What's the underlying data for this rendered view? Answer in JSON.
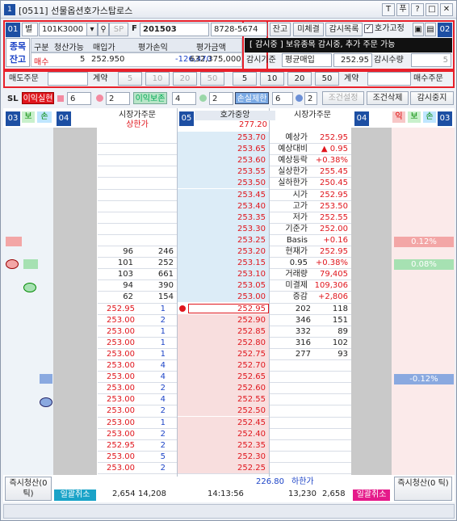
{
  "window": {
    "title": "[0511] 선물옵션호가스탑로스",
    "icon_num": "1",
    "tb_buttons": [
      "T",
      "푸",
      "?",
      "□",
      "✕"
    ]
  },
  "badges": [
    "01",
    "02",
    "03",
    "04",
    "05",
    "04",
    "03"
  ],
  "toolbar": {
    "dropdown1": "별",
    "code": "101K3000",
    "f_prefix": "F",
    "f_code": "201503",
    "account": "8728-5674",
    "btn_balance": "잔고",
    "btn_unfilled": "미체결",
    "btn_watchlist": "감시목록",
    "chk_fix": "호가고정"
  },
  "row2": {
    "tab_label": "종목잔고",
    "headers": [
      "구분",
      "청산가능",
      "매입가",
      "평가손익",
      "평가금액"
    ],
    "values": [
      "매수",
      "5",
      "252.950",
      "-126,470",
      "632,375,000"
    ],
    "status_text": "[ 감시중 ] 보유종목 감시중, 추가 주문 가능",
    "watch_base_label": "감시기준",
    "watch_base_value": "평균매입",
    "watch_price": "252.95",
    "watch_qty_label": "감시수량",
    "watch_qty": "5"
  },
  "row3": {
    "sell_label": "매도주문",
    "qty_label_left": "계약",
    "left_qtys": [
      "5",
      "10",
      "20",
      "50"
    ],
    "right_qtys": [
      "5",
      "10",
      "20",
      "50"
    ],
    "qty_label_right": "계약",
    "buy_label": "매수주문"
  },
  "row4": {
    "sl": "SL",
    "profit_btn": "이익실현",
    "profit_qty": "6",
    "profit_num": "2",
    "protect_btn": "이익보존",
    "protect_qty": "4",
    "protect_num": "2",
    "loss_btn": "손실제한",
    "loss_qty": "6",
    "loss_num": "2",
    "cond_set": "조건설정",
    "cond_del": "조건삭제",
    "stop_watch": "감시중지"
  },
  "grid": {
    "left_tabs": [
      "보",
      "손"
    ],
    "right_tabs": [
      "익",
      "보",
      "손"
    ],
    "hdr_mkt_left": "시장가주문",
    "hdr_center": "호가중앙",
    "hdr_mkt_right": "시장가주문",
    "upper_limit": "상한가",
    "upper_price": "277.20",
    "lower_limit": "하한가",
    "lower_price": "226.80",
    "prices": [
      "253.70",
      "253.65",
      "253.60",
      "253.55",
      "253.50",
      "253.45",
      "253.40",
      "253.35",
      "253.30",
      "253.25",
      "253.20",
      "253.15",
      "253.10",
      "253.05",
      "253.00",
      "252.95",
      "252.90",
      "252.85",
      "252.80",
      "252.75",
      "252.70",
      "252.65",
      "252.60",
      "252.55",
      "252.50",
      "252.45",
      "252.40",
      "252.35",
      "252.30",
      "252.25"
    ],
    "ask_cnt": [
      "96",
      "101",
      "103",
      "94",
      "62"
    ],
    "ask_qty": [
      "246",
      "252",
      "661",
      "390",
      "154"
    ],
    "bid_qty": [
      "202",
      "346",
      "332",
      "316",
      "277"
    ],
    "bid_cnt": [
      "118",
      "151",
      "89",
      "102",
      "93"
    ],
    "ord_prices": [
      "252.95",
      "253.00",
      "253.00",
      "253.00",
      "253.00",
      "253.00",
      "253.00",
      "253.00",
      "253.00",
      "253.00",
      "253.00",
      "253.00",
      "252.95",
      "253.00",
      "253.00",
      "253.00",
      "253.00"
    ],
    "ord_qtys": [
      "1",
      "2",
      "1",
      "1",
      "1",
      "4",
      "4",
      "2",
      "4",
      "2",
      "1",
      "2",
      "2",
      "5",
      "2",
      "2",
      "1"
    ],
    "info_top": [
      {
        "k": "예상가",
        "v": "252.95"
      },
      {
        "k": "예상대비",
        "v": "▲ 0.95"
      },
      {
        "k": "예상등락",
        "v": "+0.38%"
      },
      {
        "k": "실상한가",
        "v": "255.45"
      },
      {
        "k": "실하한가",
        "v": "250.45"
      }
    ],
    "info_mid": [
      {
        "k": "시가",
        "v": "252.95"
      },
      {
        "k": "고가",
        "v": "253.50"
      },
      {
        "k": "저가",
        "v": "252.55"
      },
      {
        "k": "기준가",
        "v": "252.00"
      },
      {
        "k": "Basis",
        "v": "+0.16"
      }
    ],
    "info_bot": [
      {
        "k": "현재가",
        "v": "252.95"
      },
      {
        "k": "0.95",
        "v": "+0.38%"
      },
      {
        "k": "거래량",
        "v": "79,405"
      },
      {
        "k": "미결제",
        "v": "109,306"
      },
      {
        "k": "증감",
        "v": "+2,806"
      }
    ],
    "right_pcts": [
      "0.12%",
      "0.08%",
      "-0.12%"
    ],
    "foot_left_btn": "즉시청산(0 틱)",
    "foot_right_btn": "즉시청산(0 틱)",
    "foot_cancel_l": "일괄취소",
    "foot_cancel_r": "일괄취소",
    "foot_ask_cnt": "2,654",
    "foot_ask_qty": "14,208",
    "foot_time": "14:13:56",
    "foot_bid_qty": "13,230",
    "foot_bid_cnt": "2,658"
  },
  "colors": {
    "red": "#e0161d",
    "blue": "#1d44c7",
    "badge": "#1d4fa3"
  }
}
